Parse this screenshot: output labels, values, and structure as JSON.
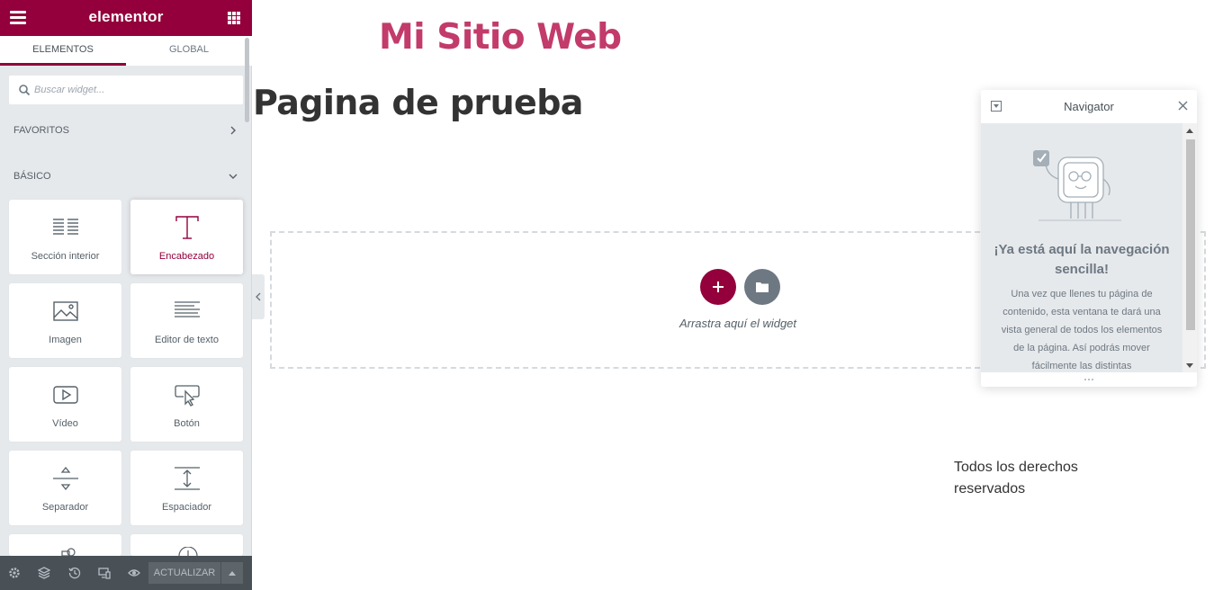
{
  "panel": {
    "logo": "elementor",
    "tabs": [
      {
        "label": "ELEMENTOS",
        "active": true
      },
      {
        "label": "GLOBAL",
        "active": false
      }
    ],
    "search": {
      "placeholder": "Buscar widget..."
    },
    "sections": {
      "favoritos": "FAVORITOS",
      "basico": "BÁSICO"
    },
    "widgets": [
      {
        "label": "Sección interior",
        "icon": "inner-section-icon"
      },
      {
        "label": "Encabezado",
        "icon": "heading-icon"
      },
      {
        "label": "Imagen",
        "icon": "image-icon"
      },
      {
        "label": "Editor de texto",
        "icon": "text-editor-icon"
      },
      {
        "label": "Vídeo",
        "icon": "video-icon"
      },
      {
        "label": "Botón",
        "icon": "button-icon"
      },
      {
        "label": "Separador",
        "icon": "divider-icon"
      },
      {
        "label": "Espaciador",
        "icon": "spacer-icon"
      }
    ],
    "footer": {
      "update_label": "ACTUALIZAR",
      "icons": [
        "settings-icon",
        "navigator-icon",
        "history-icon",
        "responsive-icon",
        "preview-icon"
      ]
    }
  },
  "canvas": {
    "site_title": "Mi Sitio Web",
    "page_title": "Pagina de prueba",
    "drop_text": "Arrastra aquí el widget",
    "footer_text": "Todos los derechos reservados"
  },
  "navigator": {
    "title": "Navigator",
    "heading": "¡Ya está aquí la navegación sencilla!",
    "description": "Una vez que llenes tu página de contenido, esta ventana te dará una vista general de todos los elementos de la página. Así podrás mover fácilmente las distintas"
  },
  "colors": {
    "brand": "#93003c",
    "site_title": "#c23b6a",
    "panel_bg": "#e6e9ec",
    "footer_bg": "#495157"
  }
}
